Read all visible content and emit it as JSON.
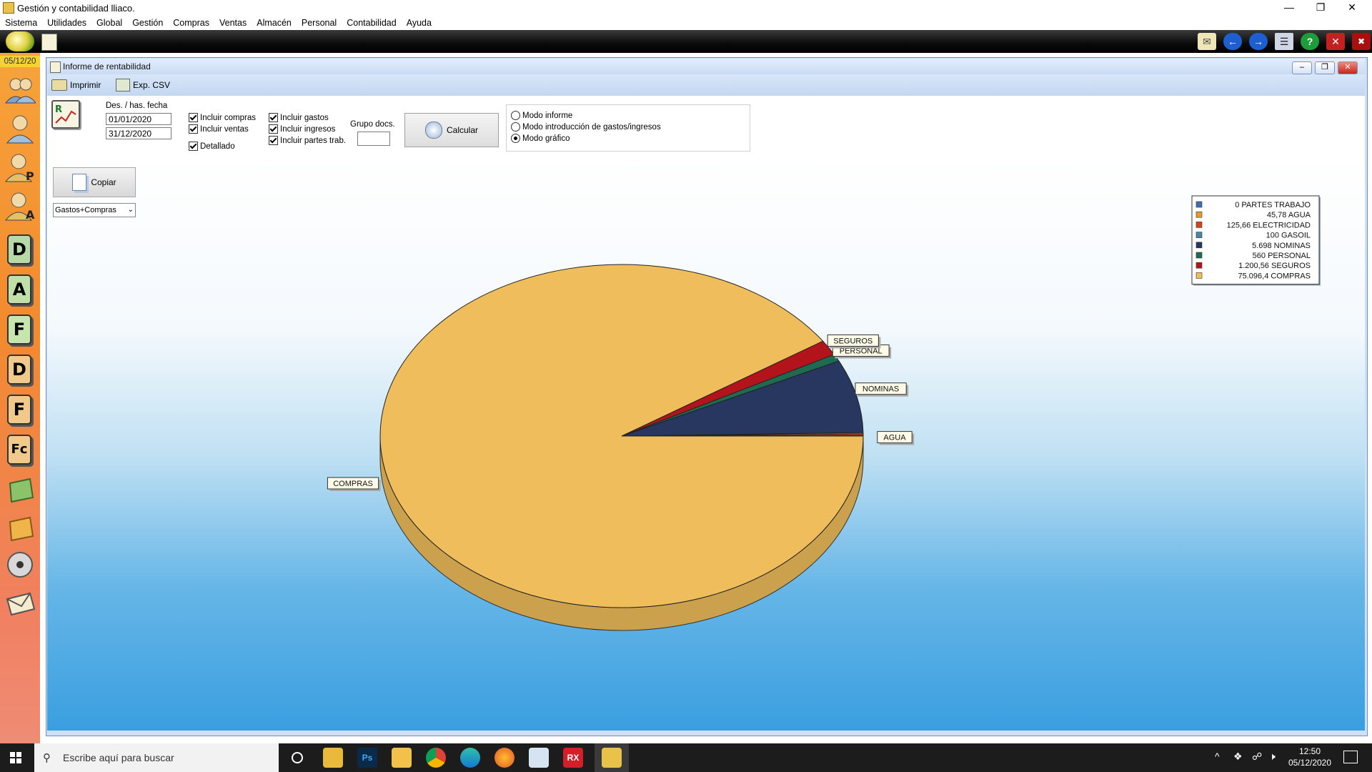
{
  "app": {
    "title": "Gestión y contabilidad lliaco.",
    "menu": [
      "Sistema",
      "Utilidades",
      "Global",
      "Gestión",
      "Compras",
      "Ventas",
      "Almacén",
      "Personal",
      "Contabilidad",
      "Ayuda"
    ],
    "date_badge": "05/12/20"
  },
  "window": {
    "title": "Informe de rentabilidad",
    "toolbar": {
      "print_label": "Imprimir",
      "export_label": "Exp. CSV"
    }
  },
  "options": {
    "date_label": "Des. / has. fecha",
    "date_from": "01/01/2020",
    "date_to": "31/12/2020",
    "chk_compras": "Incluir compras",
    "chk_ventas": "Incluir ventas",
    "chk_detallado": "Detallado",
    "chk_gastos": "Incluir gastos",
    "chk_ingresos": "Incluir ingresos",
    "chk_partes": "Incluir partes trab.",
    "grupo_label": "Grupo docs.",
    "grupo_value": "",
    "calc_label": "Calcular",
    "mode_informe": "Modo informe",
    "mode_intro": "Modo introducción de gastos/ingresos",
    "mode_grafico": "Modo gráfico",
    "selected_mode": "Modo gráfico"
  },
  "side_controls": {
    "copy_label": "Copiar",
    "series_select": "Gastos+Compras"
  },
  "chart_data": {
    "type": "pie",
    "legend_placement": "top-right",
    "slices": [
      {
        "legend": "0 PARTES TRABAJO",
        "name": "PARTES TRABAJO",
        "value": 0,
        "color": "#3f6fae",
        "label": ""
      },
      {
        "legend": "45,78 AGUA",
        "name": "AGUA",
        "value": 45.78,
        "color": "#e39a2d",
        "label": "AGUA"
      },
      {
        "legend": "125,66 ELECTRICIDAD",
        "name": "ELECTRICIDAD",
        "value": 125.66,
        "color": "#d4431a",
        "label": ""
      },
      {
        "legend": "100 GASOIL",
        "name": "GASOIL",
        "value": 100,
        "color": "#4a87a6",
        "label": ""
      },
      {
        "legend": "5.698 NOMINAS",
        "name": "NOMINAS",
        "value": 5698,
        "color": "#27375f",
        "label": "NOMINAS"
      },
      {
        "legend": "560 PERSONAL",
        "name": "PERSONAL",
        "value": 560,
        "color": "#1f6b52",
        "label": "PERSONAL"
      },
      {
        "legend": "1.200,56 SEGUROS",
        "name": "SEGUROS",
        "value": 1200.56,
        "color": "#b3141c",
        "label": "SEGUROS"
      },
      {
        "legend": "75.096,4 COMPRAS",
        "name": "COMPRAS",
        "value": 75096.4,
        "color": "#f0bd5c",
        "label": "COMPRAS"
      }
    ]
  },
  "taskbar": {
    "search_placeholder": "Escribe aquí para buscar",
    "time": "12:50",
    "date": "05/12/2020"
  }
}
